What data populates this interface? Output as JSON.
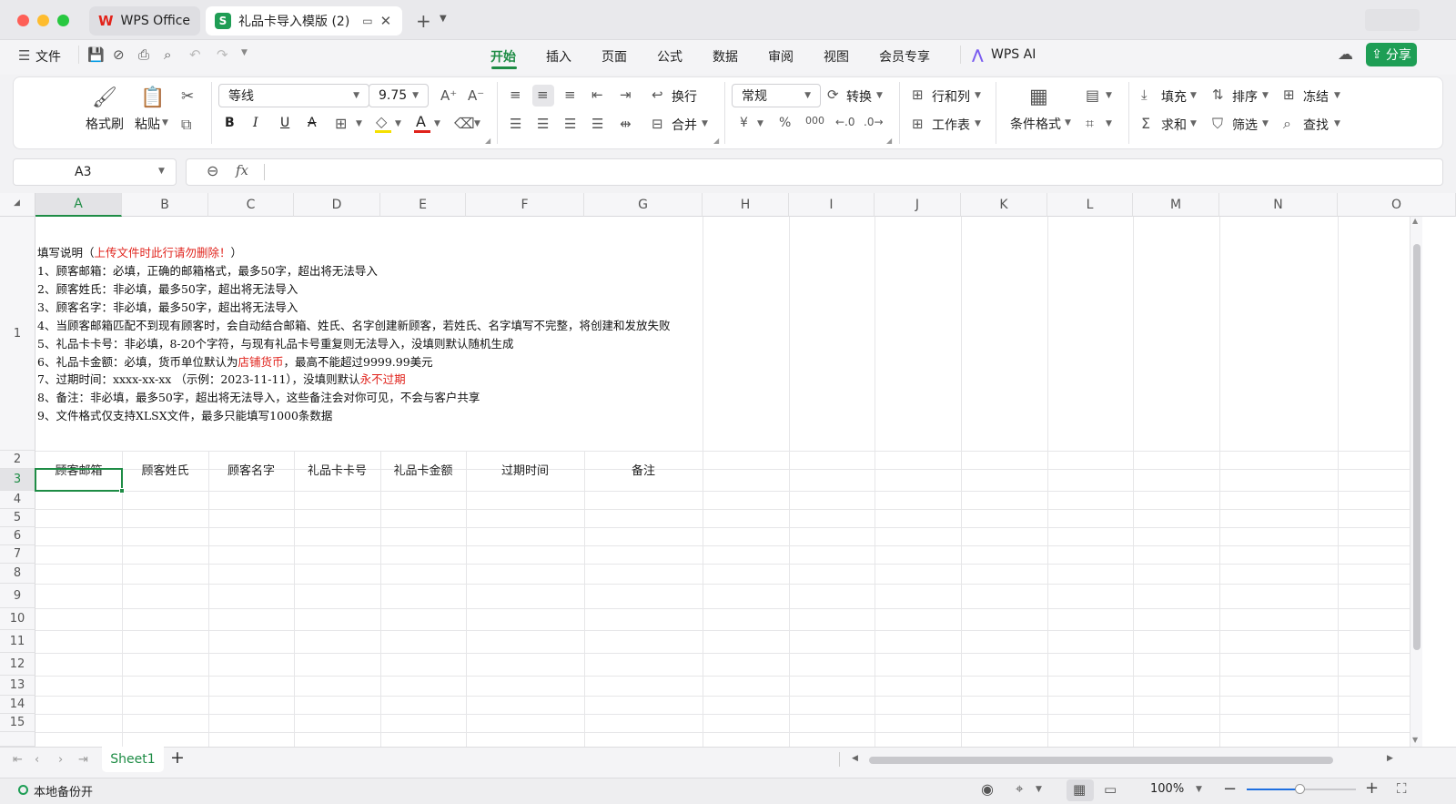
{
  "window": {
    "tabs": [
      {
        "label": "WPS Office",
        "logo": "W"
      },
      {
        "label": "礼品卡导入模版 (2)",
        "logo": "S"
      }
    ]
  },
  "menu": {
    "file": "文件",
    "tabs": [
      "开始",
      "插入",
      "页面",
      "公式",
      "数据",
      "审阅",
      "视图",
      "会员专享"
    ],
    "ai": "WPS AI",
    "share": "分享"
  },
  "ribbon": {
    "format_painter": "格式刷",
    "paste": "粘贴",
    "font_name": "等线",
    "font_size": "9.75",
    "wrap": "换行",
    "merge": "合并",
    "number_format": "常规",
    "convert": "转换",
    "row_col": "行和列",
    "worksheet": "工作表",
    "cond_format": "条件格式",
    "fill": "填充",
    "sort": "排序",
    "freeze": "冻结",
    "sum": "求和",
    "filter": "筛选",
    "find": "查找",
    "currency": "¥",
    "percent": "%",
    "thousands": "000"
  },
  "formula": {
    "cell_ref": "A3",
    "fx": "fx",
    "value": ""
  },
  "columns": [
    "A",
    "B",
    "C",
    "D",
    "E",
    "F",
    "G",
    "H",
    "I",
    "J",
    "K",
    "L",
    "M",
    "N",
    "O"
  ],
  "rows": [
    "1",
    "2",
    "3",
    "4",
    "5",
    "6",
    "7",
    "8",
    "9",
    "10",
    "11",
    "12",
    "13",
    "14",
    "15"
  ],
  "notes": {
    "title_prefix": "填写说明（",
    "title_red": "上传文件时此行请勿删除！",
    "title_suffix": "）",
    "l1": "1、顾客邮箱：必填，正确的邮箱格式，最多50字，超出将无法导入",
    "l2": "2、顾客姓氏：非必填，最多50字，超出将无法导入",
    "l3": "3、顾客名字：非必填，最多50字，超出将无法导入",
    "l4": "4、当顾客邮箱匹配不到现有顾客时，会自动结合邮箱、姓氏、名字创建新顾客，若姓氏、名字填写不完整，将创建和发放失败",
    "l5": "5、礼品卡卡号：非必填，8-20个字符，与现有礼品卡号重复则无法导入，没填则默认随机生成",
    "l6_prefix": "6、礼品卡金额：必填，货币单位默认为",
    "l6_red": "店铺货币",
    "l6_suffix": "，最高不能超过9999.99美元",
    "l7_prefix": "7、过期时间：xxxx-xx-xx  （示例：2023-11-11），没填则默认",
    "l7_red": "永不过期",
    "l8": "8、备注：非必填，最多50字，超出将无法导入，这些备注会对你可见，不会与客户共享",
    "l9": "9、文件格式仅支持XLSX文件，最多只能填写1000条数据"
  },
  "headers": [
    "顾客邮箱",
    "顾客姓氏",
    "顾客名字",
    "礼品卡卡号",
    "礼品卡金额",
    "过期时间",
    "备注"
  ],
  "sheets": [
    "Sheet1"
  ],
  "status": {
    "backup": "本地备份开",
    "zoom": "100%"
  },
  "colors": {
    "accent": "#1e8c45",
    "red": "#e0221b"
  }
}
